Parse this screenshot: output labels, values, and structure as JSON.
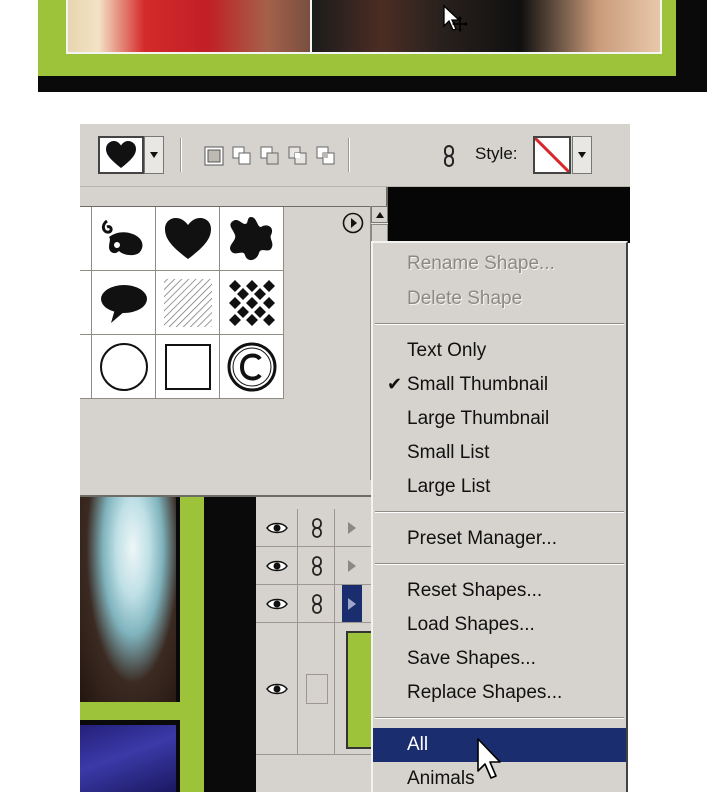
{
  "options_bar": {
    "style_label": "Style:",
    "shape_preset_icon": "heart-icon",
    "style_preset_icon": "no-style-icon"
  },
  "context_menu": {
    "items": [
      {
        "label": "Rename Shape...",
        "enabled": false
      },
      {
        "label": "Delete Shape",
        "enabled": false
      },
      {
        "label": "Text Only",
        "enabled": true
      },
      {
        "label": "Small Thumbnail",
        "enabled": true,
        "checked": true
      },
      {
        "label": "Large Thumbnail",
        "enabled": true
      },
      {
        "label": "Small List",
        "enabled": true
      },
      {
        "label": "Large List",
        "enabled": true
      },
      {
        "label": "Preset Manager...",
        "enabled": true
      },
      {
        "label": "Reset Shapes...",
        "enabled": true
      },
      {
        "label": "Load Shapes...",
        "enabled": true
      },
      {
        "label": "Save Shapes...",
        "enabled": true
      },
      {
        "label": "Replace Shapes...",
        "enabled": true
      },
      {
        "label": "All",
        "enabled": true,
        "highlighted": true
      },
      {
        "label": "Animals",
        "enabled": true
      }
    ]
  },
  "shape_grid": {
    "rows": [
      [
        "partial",
        "swirl-leaf-shape",
        "heart-shape",
        "splat-shape"
      ],
      [
        "partial",
        "speech-bubble-shape",
        "hatched-square-shape",
        "checker-diamond-shape"
      ],
      [
        "partial",
        "circle-frame-shape",
        "square-frame-shape",
        "copyright-shape"
      ]
    ]
  },
  "colors": {
    "accent_green": "#9cc33a",
    "menu_highlight": "#1a2d6e",
    "panel_gray": "#d6d3ce"
  }
}
